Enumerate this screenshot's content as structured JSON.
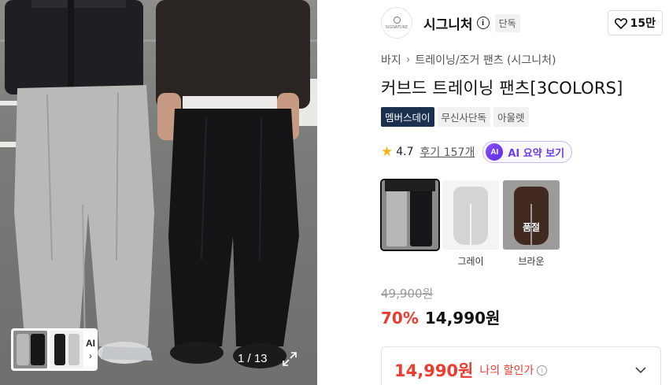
{
  "gallery": {
    "counter": "1 / 13",
    "ai_thumb_label": "AI"
  },
  "brand": {
    "logo_text": "SIGNATURE",
    "name": "시그니처",
    "info_glyph": "i",
    "exclusive_tag": "단독",
    "like_count": "15만"
  },
  "breadcrumb": {
    "category": "바지",
    "subcategory": "트레이닝/조거 팬츠 (시그니처)"
  },
  "product": {
    "title": "커브드 트레이닝 팬츠[3COLORS]"
  },
  "tags": [
    "멤버스데이",
    "무신사단독",
    "아울렛"
  ],
  "rating": {
    "value": "4.7",
    "review_text": "후기 157개",
    "ai_badge": "AI",
    "ai_summary_label": "AI 요약 보기"
  },
  "options": [
    {
      "label": "",
      "selected": true,
      "soldout": false
    },
    {
      "label": "그레이",
      "selected": false,
      "soldout": false
    },
    {
      "label": "브라운",
      "selected": false,
      "soldout": true,
      "soldout_text": "품절"
    }
  ],
  "price": {
    "original": "49,900원",
    "discount": "70%",
    "sale": "14,990원",
    "my_price": "14,990원",
    "my_price_label": "나의 할인가",
    "my_price_info_glyph": "i"
  },
  "colors": {
    "discount_red": "#ee3b2f",
    "member_tag": "#1b2f4e",
    "ai_purple": "#6a3df0"
  }
}
